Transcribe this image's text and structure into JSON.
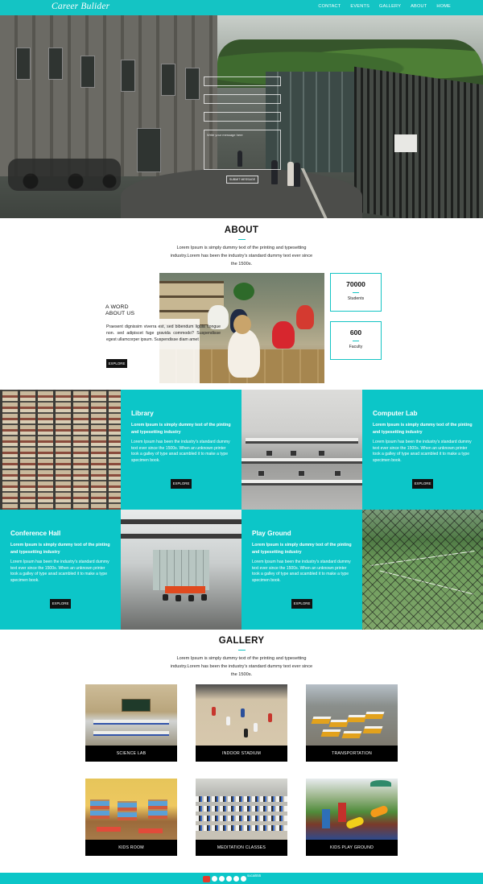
{
  "brand": "Career Bulider",
  "nav": [
    "CONTACT",
    "EVENTS",
    "GALLERY",
    "ABOUT",
    "HOME"
  ],
  "hero": {
    "fields": [
      "",
      "",
      ""
    ],
    "message_placeholder": "Write your message here",
    "submit_label": "SUBMIT MESSAGE"
  },
  "about": {
    "title": "ABOUT",
    "intro": "Lorem Ipsum is simply dummy text of the printing and typesetting industry.Lorem has been the industry's standard dummy text ever since the 1500s.",
    "word_title_line1": "A WORD",
    "word_title_line2": "ABOUT US",
    "word_text": "Praesent dignissim viverra est, sed bibendum ligula congue non. sed adipiscet fuge gravida commodo? Suspendisse egest ullamcorper ipsum. Suspendisse diam amet",
    "explore_label": "EXPLORE",
    "stats": [
      {
        "number": "70000",
        "label": "Students"
      },
      {
        "number": "600",
        "label": "Faculty"
      }
    ]
  },
  "facilities": [
    {
      "title": "Library",
      "subtitle": "Lorem Ipsum is simply dummy text of the pinting and typesetting industry",
      "body": "Lorem Ipsum has been the industry's standard dummy text ever since the 1500s. When an unknown printer took a galley of type anad scambled it to make a type specimen book.",
      "button": "EXPLORE"
    },
    {
      "title": "Computer Lab",
      "subtitle": "Lorem Ipsum is simply dummy text of the pinting and typesetting industry",
      "body": "Lorem Ipsum has been the industry's standard dummy text ever since the 1500s. When an unknown printer took a galley of type anad scambled it to make a type specimen book.",
      "button": "EXPLORE"
    },
    {
      "title": "Conference Hall",
      "subtitle": "Lorem Ipsum is simply dummy text of the pinting and typesetting industry",
      "body": "Lorem Ipsum has been the industry's standard dummy text ever since the 1500s. When an unknown printer took a galley of type anad scambled it to make a type specimen book.",
      "button": "EXPLORE"
    },
    {
      "title": "Play Ground",
      "subtitle": "Lorem Ipsum is simply dummy text of the pinting and typesetting industry",
      "body": "Lorem Ipsum has been the industry's standard dummy text ever since the 1500s. When an unknown printer took a galley of type anad scambled it to make a type specimen book.",
      "button": "EXPLORE"
    }
  ],
  "gallery": {
    "title": "GALLERY",
    "intro": "Lorem Ipsum is simply dummy text of the printing and typesetting industry.Lorem has been the industry's standard dummy text ever since the 1500s.",
    "items": [
      "SCIENCE LAB",
      "INDOOR STADIUM",
      "TRANSPORTATION",
      "KIDS ROOM",
      "MEDITATION CLASSES",
      "KIDS PLAY GROUND"
    ]
  },
  "footer": {
    "text": "sucai555"
  },
  "colors": {
    "accent": "#14c4c4",
    "tile": "#0cc6c8",
    "button": "#111111"
  }
}
